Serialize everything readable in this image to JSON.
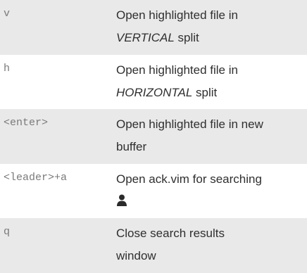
{
  "rows": [
    {
      "key": "v",
      "line1": "Open highlighted file in",
      "line2_em": "VERTICAL",
      "line2_rest": " split"
    },
    {
      "key": "h",
      "line1": "Open highlighted file in",
      "line2_em": "HORIZONTAL",
      "line2_rest": " split"
    },
    {
      "key": "<enter>",
      "line1": "Open highlighted file in new",
      "line2": "buffer"
    },
    {
      "key": "<leader>+a",
      "line1": "Open ack.vim for searching",
      "icon": "person-icon"
    },
    {
      "key": "q",
      "line1": "Close search results",
      "line2": "window"
    }
  ]
}
